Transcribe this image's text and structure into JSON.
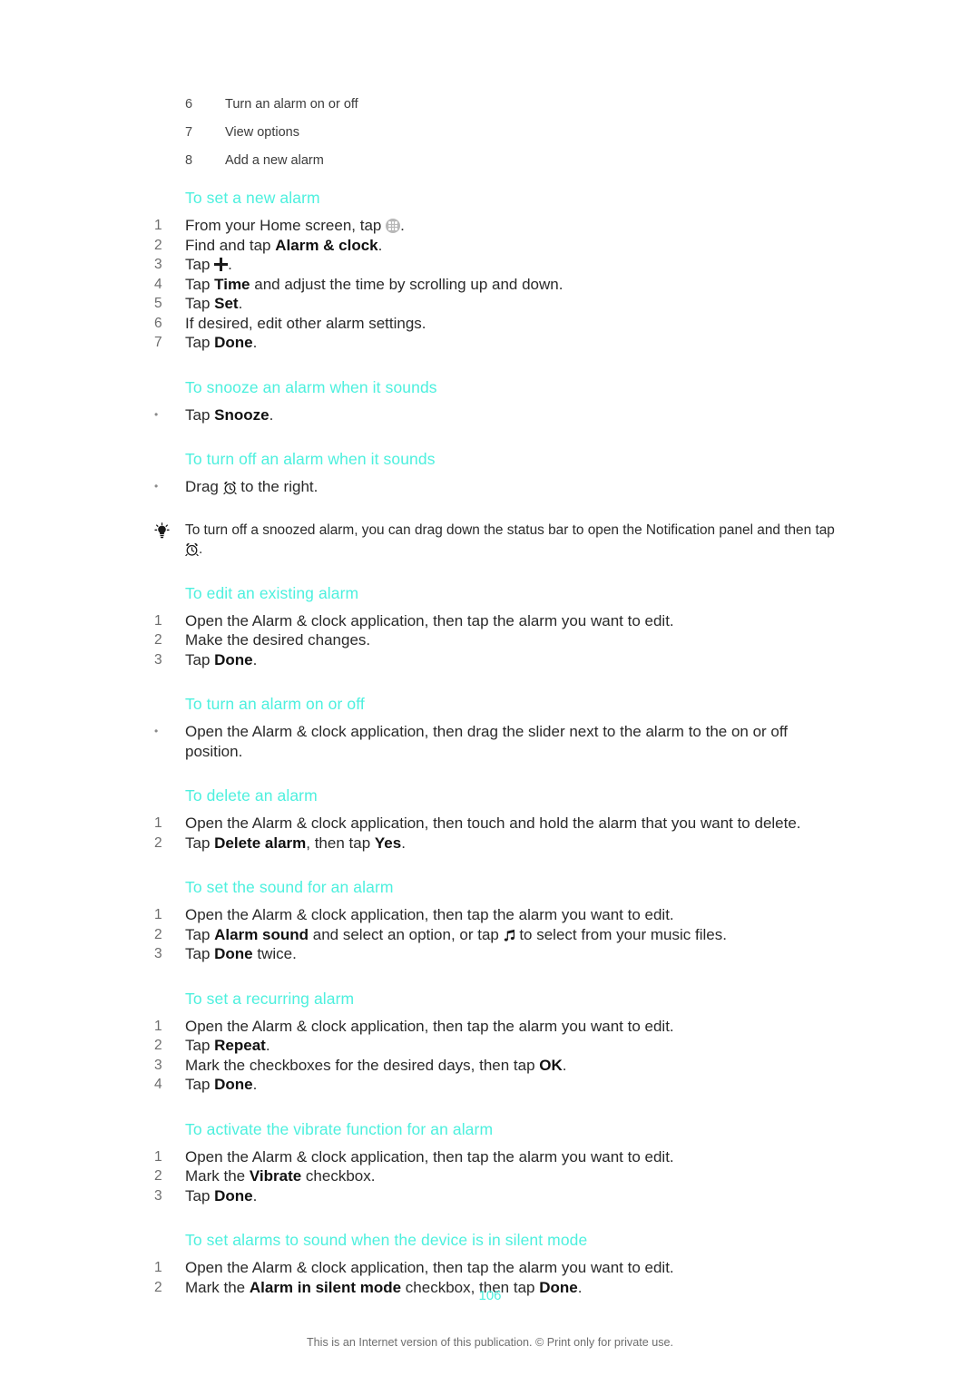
{
  "document": {
    "page_number": "106",
    "footer_note": "This is an Internet version of this publication. © Print only for private use."
  },
  "legend": {
    "items": [
      {
        "num": "6",
        "text": "Turn an alarm on or off"
      },
      {
        "num": "7",
        "text": "View options"
      },
      {
        "num": "8",
        "text": "Add a new alarm"
      }
    ]
  },
  "sections": [
    {
      "heading": "To set a new alarm",
      "list_type": "ordered",
      "items": [
        {
          "marker": "1",
          "pre": "From your Home screen, tap ",
          "icon": "app-drawer-icon",
          "post": "."
        },
        {
          "marker": "2",
          "pre": "Find and tap ",
          "bold": "Alarm & clock",
          "post": "."
        },
        {
          "marker": "3",
          "pre": "Tap ",
          "icon": "plus-icon",
          "post": "."
        },
        {
          "marker": "4",
          "pre": "Tap ",
          "bold": "Time",
          "post": " and adjust the time by scrolling up and down."
        },
        {
          "marker": "5",
          "pre": "Tap ",
          "bold": "Set",
          "post": "."
        },
        {
          "marker": "6",
          "pre": "If desired, edit other alarm settings."
        },
        {
          "marker": "7",
          "pre": "Tap ",
          "bold": "Done",
          "post": "."
        }
      ]
    },
    {
      "heading": "To snooze an alarm when it sounds",
      "list_type": "bullet",
      "items": [
        {
          "marker": "•",
          "pre": "Tap ",
          "bold": "Snooze",
          "post": "."
        }
      ]
    },
    {
      "heading": "To turn off an alarm when it sounds",
      "list_type": "bullet",
      "items": [
        {
          "marker": "•",
          "pre": "Drag ",
          "icon": "alarm-clock-icon",
          "post": " to the right."
        }
      ]
    },
    {
      "heading": "To edit an existing alarm",
      "list_type": "ordered",
      "items": [
        {
          "marker": "1",
          "pre": "Open the Alarm & clock application, then tap the alarm you want to edit."
        },
        {
          "marker": "2",
          "pre": "Make the desired changes."
        },
        {
          "marker": "3",
          "pre": "Tap ",
          "bold": "Done",
          "post": "."
        }
      ]
    },
    {
      "heading": "To turn an alarm on or off",
      "list_type": "bullet",
      "items": [
        {
          "marker": "•",
          "pre": "Open the Alarm & clock application, then drag the slider next to the alarm to the on or off position."
        }
      ]
    },
    {
      "heading": "To delete an alarm",
      "list_type": "ordered",
      "items": [
        {
          "marker": "1",
          "pre": "Open the Alarm & clock application, then touch and hold the alarm that you want to delete."
        },
        {
          "marker": "2",
          "pre": "Tap ",
          "bold": "Delete alarm",
          "mid": ", then tap ",
          "bold2": "Yes",
          "post": "."
        }
      ]
    },
    {
      "heading": "To set the sound for an alarm",
      "list_type": "ordered",
      "items": [
        {
          "marker": "1",
          "pre": "Open the Alarm & clock application, then tap the alarm you want to edit."
        },
        {
          "marker": "2",
          "pre": "Tap ",
          "bold": "Alarm sound",
          "mid": " and select an option, or tap ",
          "icon": "music-note-icon",
          "post": " to select from your music files."
        },
        {
          "marker": "3",
          "pre": "Tap ",
          "bold": "Done",
          "post": " twice."
        }
      ]
    },
    {
      "heading": "To set a recurring alarm",
      "list_type": "ordered",
      "items": [
        {
          "marker": "1",
          "pre": "Open the Alarm & clock application, then tap the alarm you want to edit."
        },
        {
          "marker": "2",
          "pre": "Tap ",
          "bold": "Repeat",
          "post": "."
        },
        {
          "marker": "3",
          "pre": "Mark the checkboxes for the desired days, then tap ",
          "bold": "OK",
          "post": "."
        },
        {
          "marker": "4",
          "pre": "Tap ",
          "bold": "Done",
          "post": "."
        }
      ]
    },
    {
      "heading": "To activate the vibrate function for an alarm",
      "list_type": "ordered",
      "items": [
        {
          "marker": "1",
          "pre": "Open the Alarm & clock application, then tap the alarm you want to edit."
        },
        {
          "marker": "2",
          "pre": "Mark the ",
          "bold": "Vibrate",
          "post": " checkbox."
        },
        {
          "marker": "3",
          "pre": "Tap ",
          "bold": "Done",
          "post": "."
        }
      ]
    },
    {
      "heading": "To set alarms to sound when the device is in silent mode",
      "list_type": "ordered",
      "items": [
        {
          "marker": "1",
          "pre": "Open the Alarm & clock application, then tap the alarm you want to edit."
        },
        {
          "marker": "2",
          "pre": "Mark the ",
          "bold": "Alarm in silent mode",
          "mid": " checkbox, then tap ",
          "bold2": "Done",
          "post": "."
        }
      ]
    }
  ],
  "tip": {
    "icon": "lightbulb-tip-icon",
    "pre": "To turn off a snoozed alarm, you can drag down the status bar to open the Notification panel and then tap ",
    "icon_inline": "alarm-clock-icon",
    "post": "."
  },
  "colors": {
    "heading": "#4df0de",
    "page_number": "#4df0de",
    "body_text": "#2a2a2a",
    "marker_text": "#6d6d6d",
    "footer_text": "#6e6e6e",
    "background": "#ffffff"
  }
}
